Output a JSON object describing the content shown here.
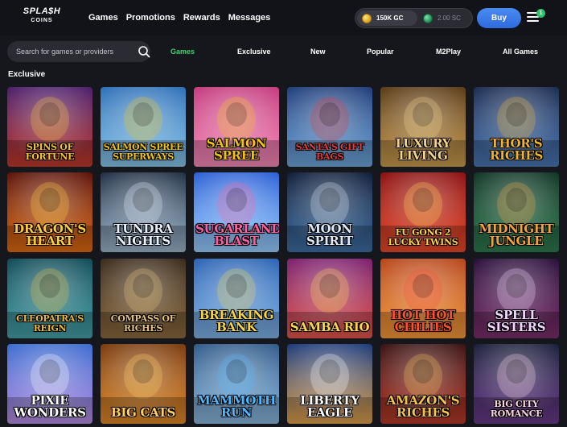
{
  "header": {
    "logo_line1": "SPLA$H",
    "logo_line2": "COINS",
    "nav": [
      "Games",
      "Promotions",
      "Rewards",
      "Messages"
    ],
    "gold_coins": "150K GC",
    "sweeps_coins": "2.00 SC",
    "buy_label": "Buy",
    "notification_count": "1"
  },
  "search": {
    "placeholder": "Search for games or providers"
  },
  "tabs": [
    {
      "label": "Games",
      "active": true
    },
    {
      "label": "Exclusive",
      "active": false
    },
    {
      "label": "New",
      "active": false
    },
    {
      "label": "Popular",
      "active": false
    },
    {
      "label": "M2Play",
      "active": false
    },
    {
      "label": "All Games",
      "active": false
    }
  ],
  "section": {
    "title": "Exclusive"
  },
  "games": [
    {
      "title": "Spins of Fortune",
      "bg": [
        "#4b1d6b",
        "#c0392b"
      ],
      "accent": "#f4c430"
    },
    {
      "title": "Salmon Spree Superways",
      "bg": [
        "#2d6fb8",
        "#88c5e8"
      ],
      "accent": "#f1c40f"
    },
    {
      "title": "Salmon Spree",
      "bg": [
        "#c43a7d",
        "#f58ab8"
      ],
      "accent": "#f1c40f"
    },
    {
      "title": "Santa's Gift Bags",
      "bg": [
        "#1e3c7a",
        "#6fa8dc"
      ],
      "accent": "#e23b3b"
    },
    {
      "title": "Luxury Living",
      "bg": [
        "#5a3a15",
        "#c99b4e"
      ],
      "accent": "#f3d38a"
    },
    {
      "title": "Thor's Riches",
      "bg": [
        "#1b2c52",
        "#4a77b4"
      ],
      "accent": "#f0b429"
    },
    {
      "title": "Dragon's Heart",
      "bg": [
        "#5c1208",
        "#e06b14"
      ],
      "accent": "#ffcc33"
    },
    {
      "title": "Tundra Nights",
      "bg": [
        "#1f2f45",
        "#9cb6cc"
      ],
      "accent": "#e6f1ff"
    },
    {
      "title": "Sugarland Blast",
      "bg": [
        "#2a5fd6",
        "#9ad0ff"
      ],
      "accent": "#ff5fa2"
    },
    {
      "title": "Moon Spirit",
      "bg": [
        "#0e1d3a",
        "#3f6fa3"
      ],
      "accent": "#dfe8f5"
    },
    {
      "title": "Fu Gong 2 Lucky Twins",
      "bg": [
        "#8c1010",
        "#e84a2a"
      ],
      "accent": "#ffd24a"
    },
    {
      "title": "Midnight Jungle",
      "bg": [
        "#0f3524",
        "#2f7a4f"
      ],
      "accent": "#f2a33a"
    },
    {
      "title": "Cleopatra's Reign",
      "bg": [
        "#0f4a56",
        "#46a1a8"
      ],
      "accent": "#e8b93a"
    },
    {
      "title": "Compass of Riches",
      "bg": [
        "#3a2a1a",
        "#8a6a3e"
      ],
      "accent": "#e8c27a"
    },
    {
      "title": "Breaking Bank",
      "bg": [
        "#2b63b4",
        "#7fb2e6"
      ],
      "accent": "#f5d547"
    },
    {
      "title": "Samba Rio",
      "bg": [
        "#7a1f6e",
        "#e2564a"
      ],
      "accent": "#ffd84d"
    },
    {
      "title": "Hot Hot Chilies",
      "bg": [
        "#b8451a",
        "#f29a3a"
      ],
      "accent": "#ff4d2e"
    },
    {
      "title": "Spell Sisters",
      "bg": [
        "#2a0f3a",
        "#7a2f6a"
      ],
      "accent": "#f0d6ff"
    },
    {
      "title": "Pixie Wonders",
      "bg": [
        "#3a6ad0",
        "#b58de0"
      ],
      "accent": "#ffffff"
    },
    {
      "title": "Big Cats",
      "bg": [
        "#7a3a0c",
        "#e08a2a"
      ],
      "accent": "#ffd166"
    },
    {
      "title": "Mammoth Run",
      "bg": [
        "#2f5a8a",
        "#8ab8de"
      ],
      "accent": "#4fb8ff"
    },
    {
      "title": "Liberty Eagle",
      "bg": [
        "#1b3a7a",
        "#e0a04a"
      ],
      "accent": "#ffffff"
    },
    {
      "title": "Amazon's Riches",
      "bg": [
        "#3a1212",
        "#b83a2a"
      ],
      "accent": "#f2c14e"
    },
    {
      "title": "Big City Romance",
      "bg": [
        "#1a1f3a",
        "#6a3a8a"
      ],
      "accent": "#ffd6e8"
    }
  ],
  "colors": {
    "active_tab": "#3fd56d",
    "buy_button": "#3a7ae8",
    "badge": "#2cc36b"
  }
}
